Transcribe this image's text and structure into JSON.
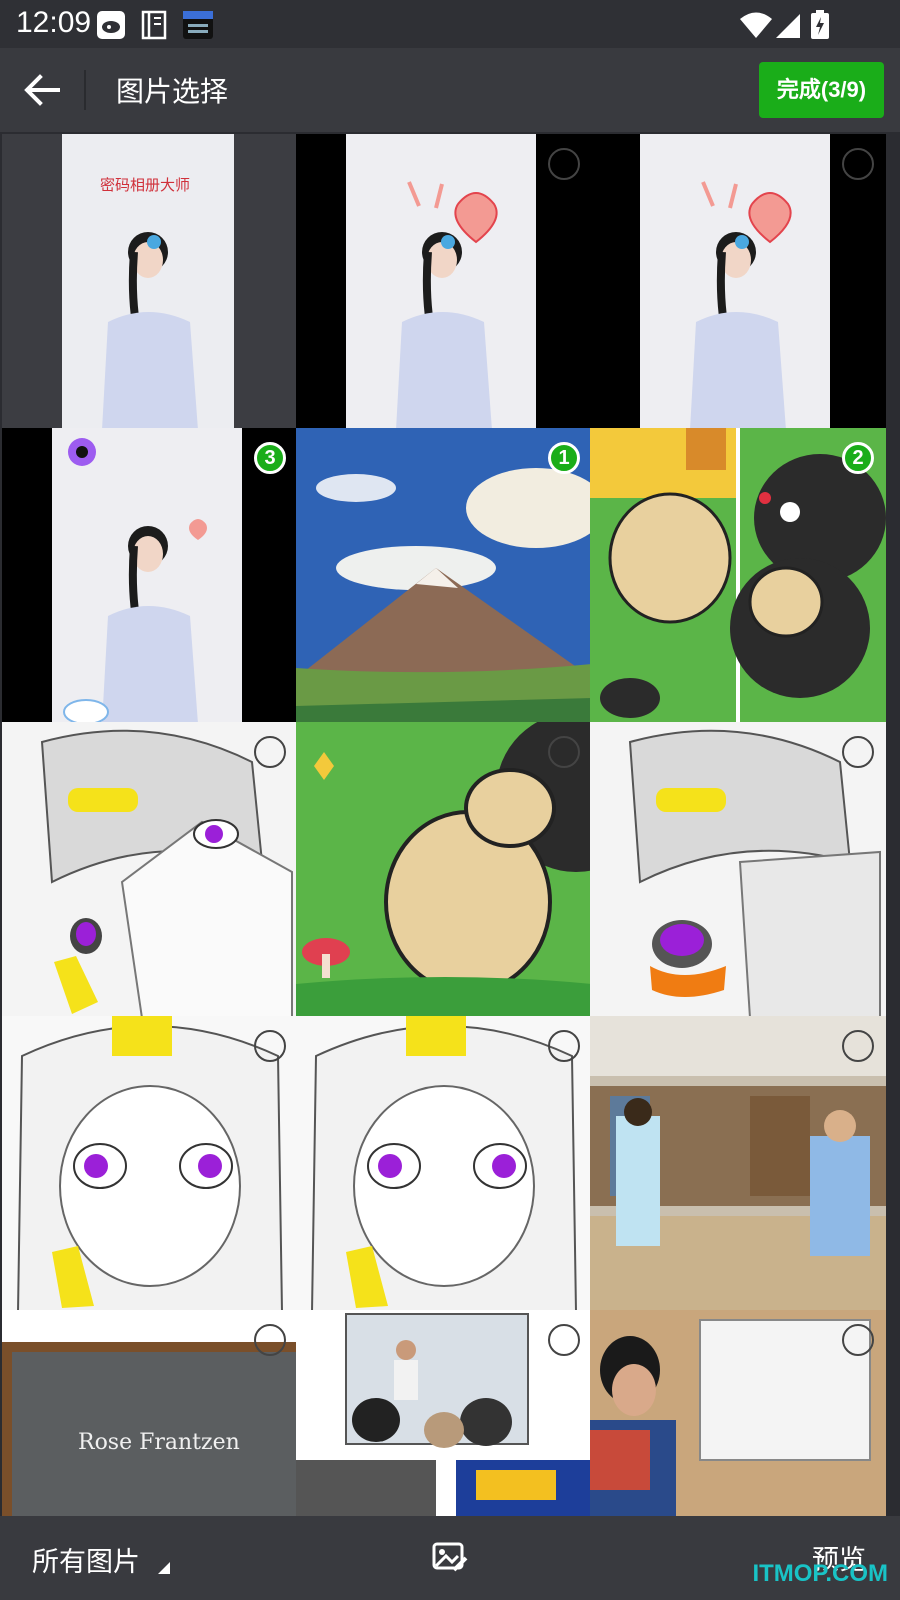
{
  "status_bar": {
    "time": "12:09",
    "icons": [
      "sina-icon",
      "sim-icon",
      "calendar-icon",
      "wifi-icon",
      "signal-icon",
      "battery-icon"
    ]
  },
  "header": {
    "title": "图片选择",
    "done_label": "完成(3/9)"
  },
  "grid": {
    "tiles": [
      {
        "name": "photo-portrait-album",
        "caption": "密码相册大师",
        "selected_index": null
      },
      {
        "name": "photo-portrait-heart-1",
        "caption": "",
        "selected_index": null
      },
      {
        "name": "photo-portrait-heart-2",
        "caption": "",
        "selected_index": null
      },
      {
        "name": "photo-portrait-flower",
        "caption": "",
        "selected_index": "3"
      },
      {
        "name": "photo-mountain",
        "caption": "",
        "selected_index": "1"
      },
      {
        "name": "photo-cartoon-dogs",
        "caption": "",
        "selected_index": "2"
      },
      {
        "name": "photo-sketch-girl",
        "caption": "",
        "selected_index": null
      },
      {
        "name": "photo-cartoon-dog",
        "caption": "",
        "selected_index": null
      },
      {
        "name": "photo-sketch-paint",
        "caption": "",
        "selected_index": null
      },
      {
        "name": "photo-anime-girl-1",
        "caption": "",
        "selected_index": null
      },
      {
        "name": "photo-anime-girl-2",
        "caption": "",
        "selected_index": null
      },
      {
        "name": "photo-library",
        "caption": "",
        "selected_index": null
      },
      {
        "name": "photo-chalkboard",
        "caption": "Rose Frantzen",
        "selected_index": null
      },
      {
        "name": "photo-classroom",
        "caption": "",
        "selected_index": null
      },
      {
        "name": "photo-whiteboard",
        "caption": "",
        "selected_index": null
      }
    ]
  },
  "footer": {
    "album_label": "所有图片",
    "preview_label": "预览"
  },
  "watermark": "ITMOP.COM",
  "colors": {
    "accent": "#1aad19",
    "appbar": "#393a3f",
    "background": "#2b2c31"
  }
}
